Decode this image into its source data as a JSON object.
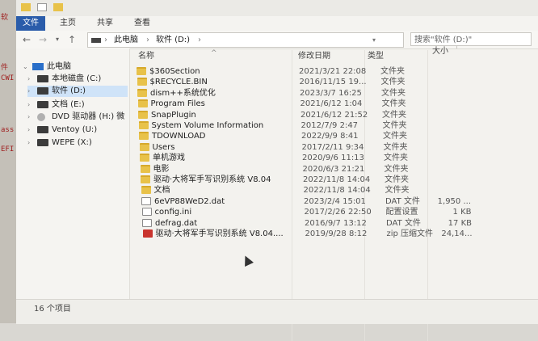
{
  "left_strip": {
    "labels": [
      "软",
      "件",
      "CWI",
      "ass",
      "EFI"
    ]
  },
  "ribbon": {
    "tabs": [
      "文件",
      "主页",
      "共享",
      "查看"
    ],
    "active_index": 0
  },
  "address": {
    "path": [
      "此电脑",
      "软件 (D:)"
    ],
    "search_placeholder": "搜索\"软件 (D:)\""
  },
  "nav": {
    "items": [
      {
        "label": "此电脑",
        "icon": "pc-icon",
        "level": 0
      },
      {
        "label": "本地磁盘 (C:)",
        "icon": "drive-icon",
        "level": 1
      },
      {
        "label": "软件 (D:)",
        "icon": "drive-icon",
        "level": 1,
        "selected": true
      },
      {
        "label": "文档 (E:)",
        "icon": "drive-icon",
        "level": 1
      },
      {
        "label": "DVD 驱动器 (H:) 微",
        "icon": "disc-icon",
        "level": 1
      },
      {
        "label": "Ventoy (U:)",
        "icon": "drive-icon",
        "level": 1
      },
      {
        "label": "WEPE (X:)",
        "icon": "drive-icon",
        "level": 1
      }
    ]
  },
  "columns": {
    "name": "名称",
    "date": "修改日期",
    "type": "类型",
    "size": "大小"
  },
  "files": [
    {
      "name": "$360Section",
      "date": "2021/3/21 22:08",
      "type": "文件夹",
      "size": "",
      "icon": "folder-icon"
    },
    {
      "name": "$RECYCLE.BIN",
      "date": "2016/11/15 19...",
      "type": "文件夹",
      "size": "",
      "icon": "folder-icon"
    },
    {
      "name": "dism++系统优化",
      "date": "2023/3/7 16:25",
      "type": "文件夹",
      "size": "",
      "icon": "folder-icon"
    },
    {
      "name": "Program Files",
      "date": "2021/6/12 1:04",
      "type": "文件夹",
      "size": "",
      "icon": "folder-icon"
    },
    {
      "name": "SnapPlugin",
      "date": "2021/6/12 21:52",
      "type": "文件夹",
      "size": "",
      "icon": "folder-icon"
    },
    {
      "name": "System Volume Information",
      "date": "2012/7/9 2:47",
      "type": "文件夹",
      "size": "",
      "icon": "folder-icon"
    },
    {
      "name": "TDOWNLOAD",
      "date": "2022/9/9 8:41",
      "type": "文件夹",
      "size": "",
      "icon": "folder-icon"
    },
    {
      "name": "Users",
      "date": "2017/2/11 9:34",
      "type": "文件夹",
      "size": "",
      "icon": "folder-icon"
    },
    {
      "name": "单机游戏",
      "date": "2020/9/6 11:13",
      "type": "文件夹",
      "size": "",
      "icon": "folder-icon"
    },
    {
      "name": "电影",
      "date": "2020/6/3 21:21",
      "type": "文件夹",
      "size": "",
      "icon": "folder-icon"
    },
    {
      "name": "驱动·大将军手写识别系统 V8.04",
      "date": "2022/11/8 14:04",
      "type": "文件夹",
      "size": "",
      "icon": "folder-icon"
    },
    {
      "name": "文档",
      "date": "2022/11/8 14:04",
      "type": "文件夹",
      "size": "",
      "icon": "folder-icon"
    },
    {
      "name": "6eVP88WeD2.dat",
      "date": "2023/2/4 15:01",
      "type": "DAT 文件",
      "size": "1,950 ...",
      "icon": "file-icon"
    },
    {
      "name": "config.ini",
      "date": "2017/2/26 22:50",
      "type": "配置设置",
      "size": "1 KB",
      "icon": "file-icon"
    },
    {
      "name": "defrag.dat",
      "date": "2016/9/7 13:12",
      "type": "DAT 文件",
      "size": "17 KB",
      "icon": "file-icon"
    },
    {
      "name": "驱动·大将军手写识别系统 V8.04....",
      "date": "2019/9/28 8:12",
      "type": "zip 压缩文件",
      "size": "24,14...",
      "icon": "zip-icon"
    }
  ],
  "status": {
    "count_text": "16 个项目"
  }
}
